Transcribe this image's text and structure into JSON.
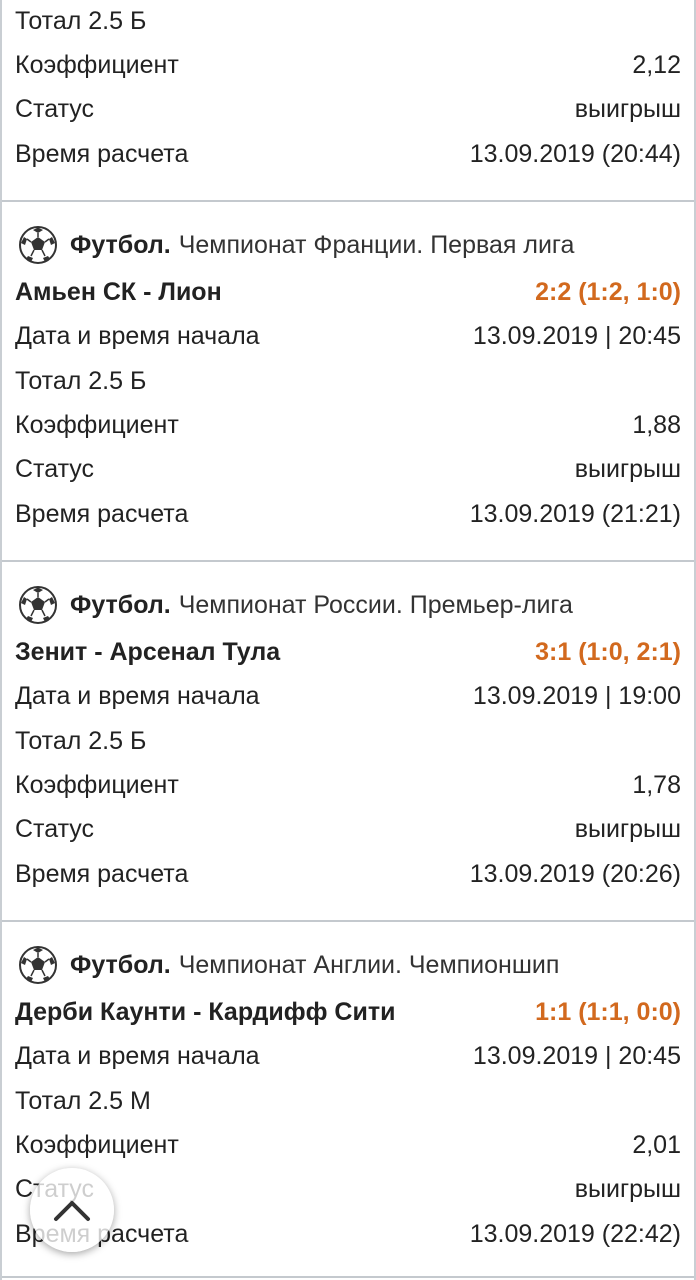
{
  "top_partial": {
    "rows": [
      {
        "label": "Тотал 2.5 Б",
        "value": ""
      },
      {
        "label": "Коэффициент",
        "value": "2,12"
      },
      {
        "label": "Статус",
        "value": "выигрыш"
      },
      {
        "label": "Время расчета",
        "value": "13.09.2019 (20:44)"
      }
    ]
  },
  "bets": [
    {
      "sport": "Футбол.",
      "league": "Чемпионат Франции. Первая лига",
      "match": "Амьен СК - Лион",
      "score": "2:2 (1:2, 1:0)",
      "start_label": "Дата и время начала",
      "start_value": "13.09.2019 | 20:45",
      "bet": "Тотал 2.5 Б",
      "coef_label": "Коэффициент",
      "coef_value": "1,88",
      "status_label": "Статус",
      "status_value": "выигрыш",
      "calc_label": "Время расчета",
      "calc_value": "13.09.2019 (21:21)"
    },
    {
      "sport": "Футбол.",
      "league": "Чемпионат России. Премьер-лига",
      "match": "Зенит - Арсенал Тула",
      "score": "3:1 (1:0, 2:1)",
      "start_label": "Дата и время начала",
      "start_value": "13.09.2019 | 19:00",
      "bet": "Тотал 2.5 Б",
      "coef_label": "Коэффициент",
      "coef_value": "1,78",
      "status_label": "Статус",
      "status_value": "выигрыш",
      "calc_label": "Время расчета",
      "calc_value": "13.09.2019 (20:26)"
    },
    {
      "sport": "Футбол.",
      "league": "Чемпионат Англии. Чемпионшип",
      "match": "Дерби Каунти - Кардифф Сити",
      "score": "1:1 (1:1, 0:0)",
      "start_label": "Дата и время начала",
      "start_value": "13.09.2019 | 20:45",
      "bet": "Тотал 2.5 М",
      "coef_label": "Коэффициент",
      "coef_value": "2,01",
      "status_label": "Статус",
      "status_value": "выигрыш",
      "calc_label": "Время расчета",
      "calc_value": "13.09.2019 (22:42)"
    }
  ],
  "scroll_top_icon": "chevron-up-icon",
  "colors": {
    "score": "#d2691e",
    "separator": "#c4c9ce"
  }
}
